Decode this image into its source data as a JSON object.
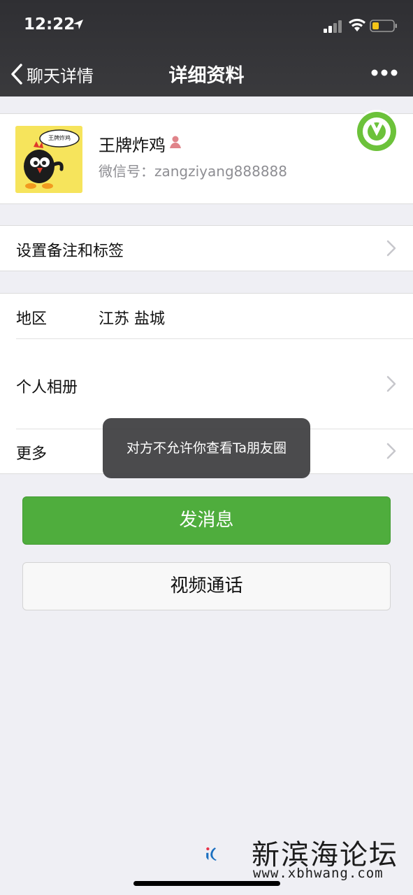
{
  "status_bar": {
    "time": "12:22"
  },
  "nav": {
    "back_label": "聊天详情",
    "title": "详细资料"
  },
  "profile": {
    "name": "王牌炸鸡",
    "wechat_id": "微信号：zangziyang888888",
    "avatar_caption": "王牌炸鸡"
  },
  "cells": {
    "remark": "设置备注和标签",
    "region_label": "地区",
    "region_value": "江苏  盐城",
    "album": "个人相册",
    "more": "更多"
  },
  "toast": "对方不允许你查看Ta朋友圈",
  "buttons": {
    "send_message": "发消息",
    "video_call": "视频通话"
  },
  "watermark": {
    "site_name": "新滨海论坛",
    "url": "www.xbhwang.com"
  },
  "colors": {
    "header": "#353538",
    "primary": "#4fad3d",
    "background": "#efeff4"
  }
}
